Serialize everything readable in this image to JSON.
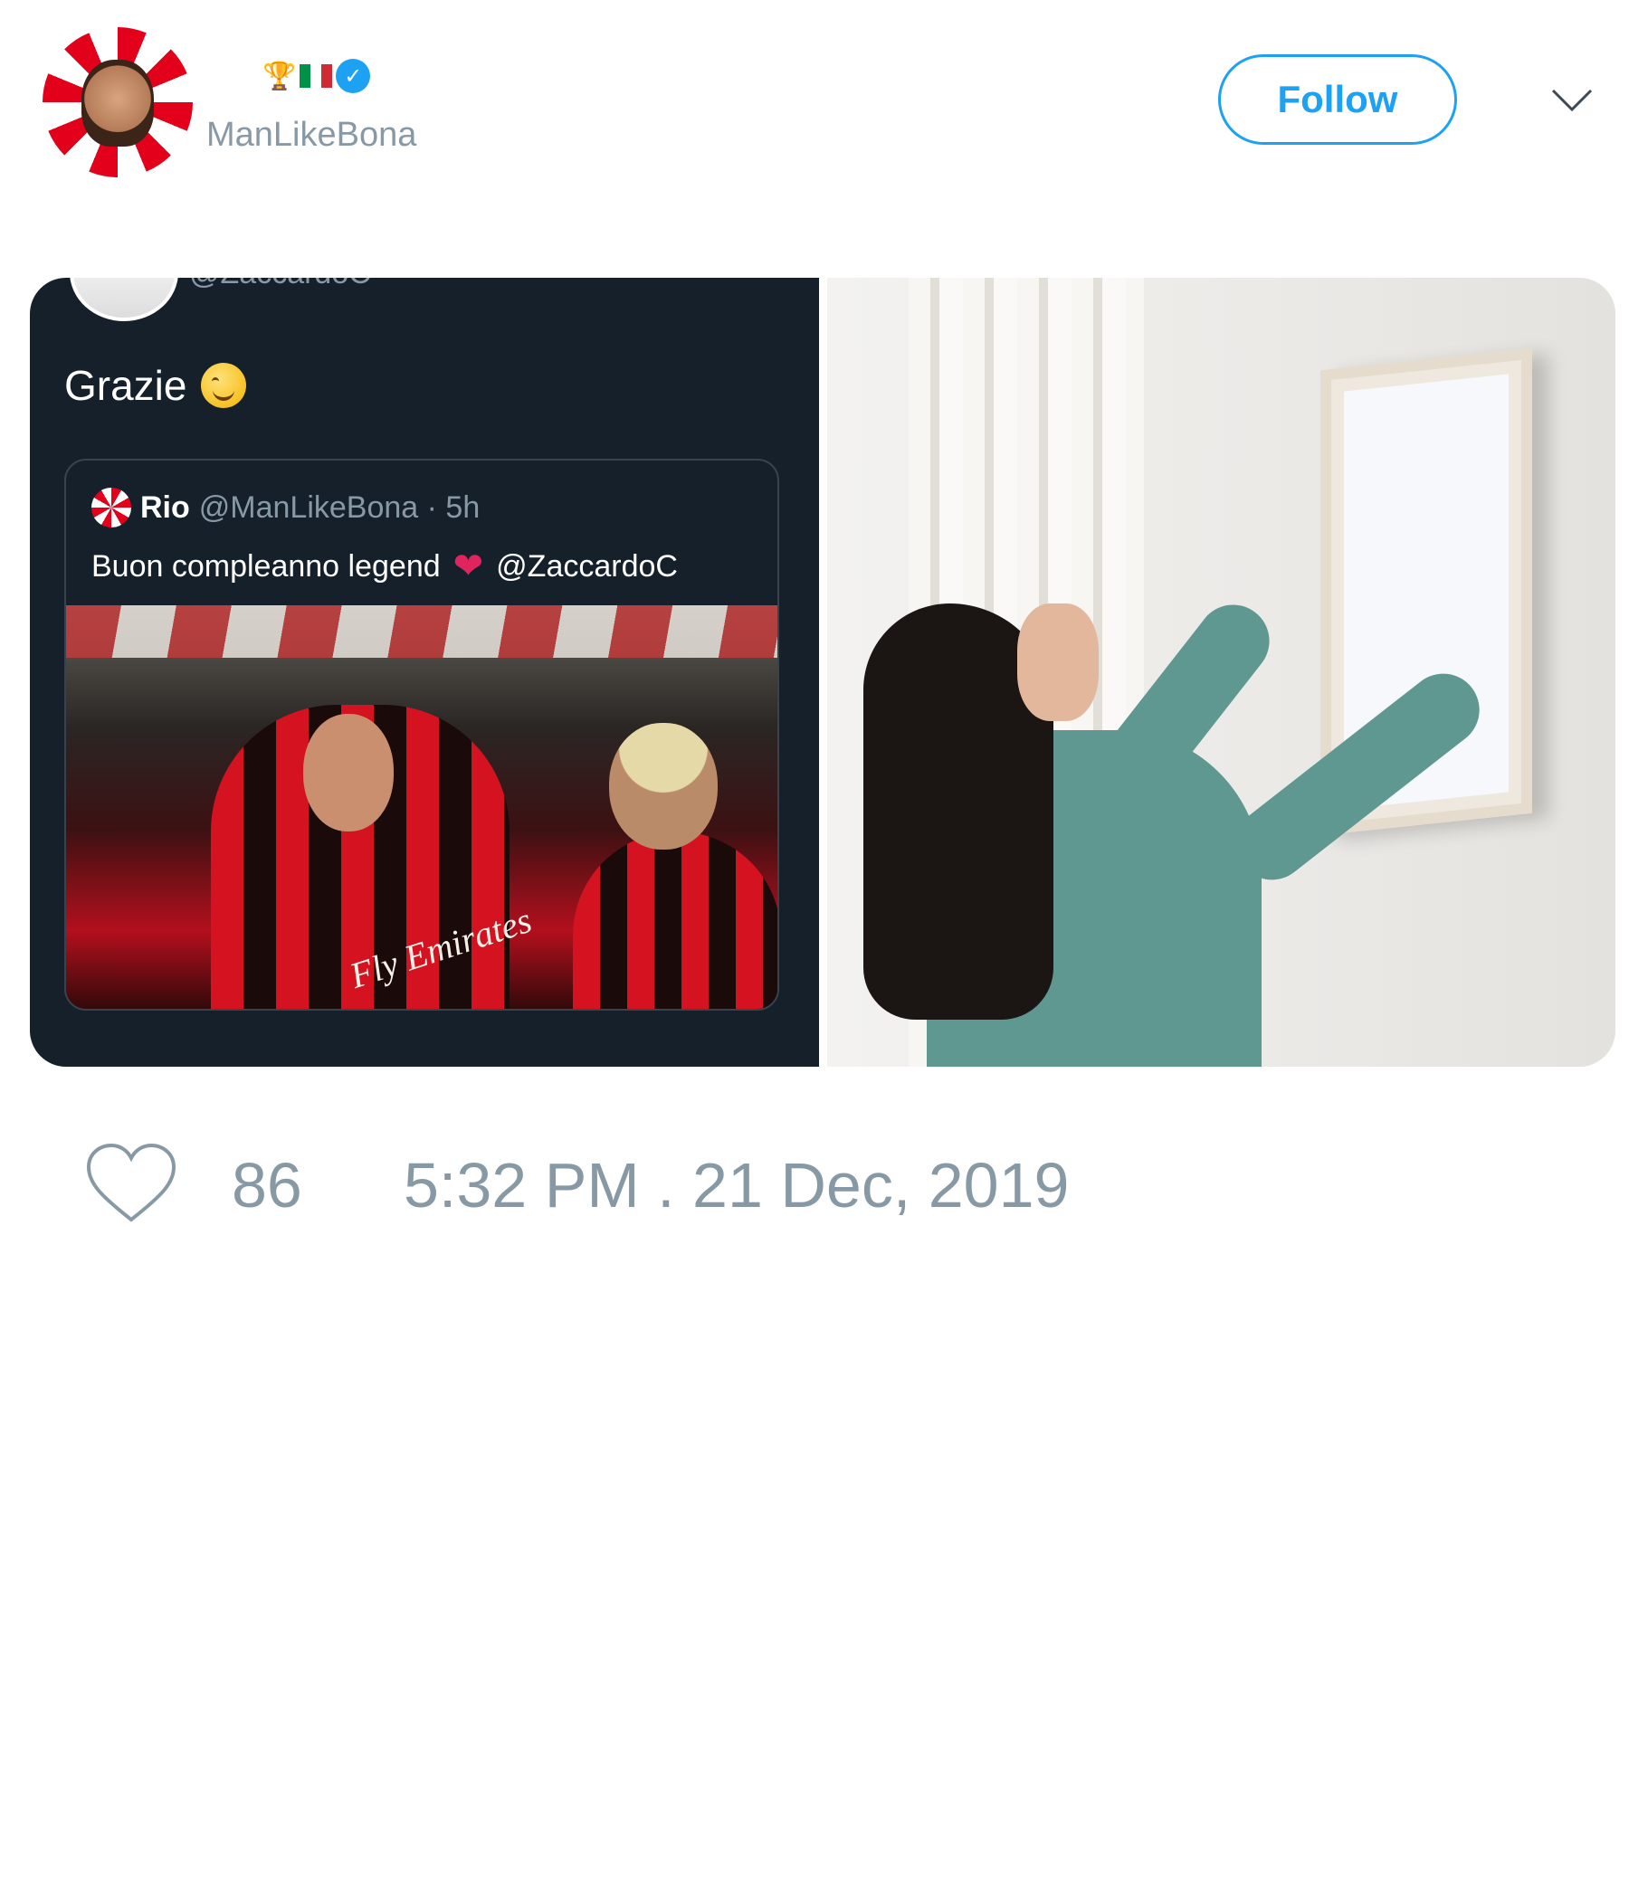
{
  "header": {
    "handle": "ManLikeBona",
    "badges": [
      "trophy-icon",
      "italy-flag-icon",
      "verified-icon"
    ],
    "follow_label": "Follow",
    "menu_icon": "chevron-down-icon"
  },
  "media": {
    "left_screenshot": {
      "cut_handle": "@ZaccardoC",
      "reply_text": "Grazie",
      "quoted_tweet": {
        "name": "Rio",
        "meta": "@ManLikeBona · 5h",
        "text_before": "Buon compleanno legend",
        "text_after": "@ZaccardoC",
        "photo_text_sponsor": "Fly Emirates"
      }
    },
    "right_image": {}
  },
  "footer": {
    "like_icon": "heart-icon",
    "like_count": "86",
    "timestamp": "5:32 PM . 21 Dec, 2019"
  },
  "colors": {
    "accent": "#1da1f2",
    "muted": "#8899a6",
    "dark_panel": "#15202b",
    "milan_red": "#d5121f"
  }
}
